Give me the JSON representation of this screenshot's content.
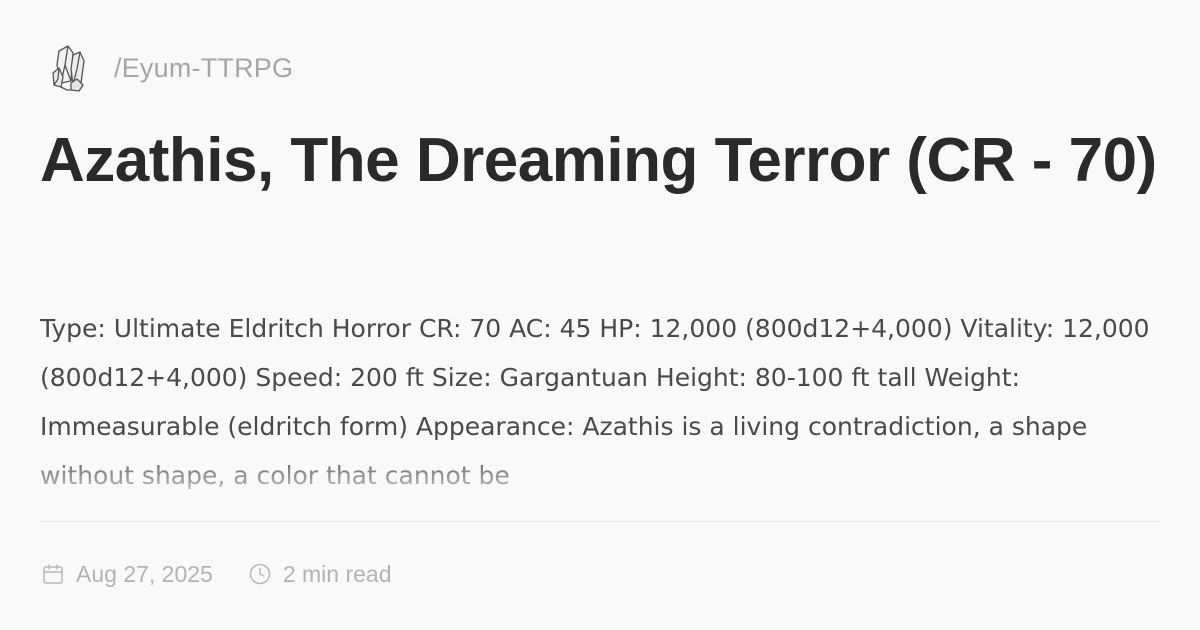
{
  "site": {
    "logo_icon": "crystal-cluster-icon",
    "name": "/Eyum-TTRPG"
  },
  "post": {
    "title": "Azathis, The Dreaming Terror (CR - 70)",
    "excerpt": "Type: Ultimate Eldritch Horror CR: 70 AC: 45 HP: 12,000 (800d12+4,000) Vitality: 12,000 (800d12+4,000) Speed: 200 ft Size: Gargantuan Height: 80-100 ft tall Weight: Immeasurable (eldritch form) Appearance: Azathis is a living contradiction, a shape without shape, a color that cannot be",
    "date": "Aug 27, 2025",
    "date_icon": "calendar-icon",
    "read_time": "2 min read",
    "read_time_icon": "clock-icon"
  },
  "colors": {
    "background": "#f9f9f9",
    "title": "#2a2a2a",
    "body_text": "#4a4a4a",
    "muted": "#a6a6a6",
    "divider": "#e6e6e6"
  }
}
